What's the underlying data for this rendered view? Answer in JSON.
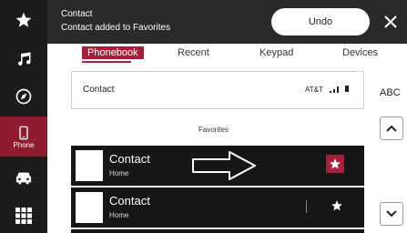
{
  "banner": {
    "title": "Contact",
    "message": "Contact added to Favorites",
    "undo_label": "Undo",
    "close_icon": "close-icon"
  },
  "sidebar": {
    "items": [
      {
        "name": "favorites",
        "icon": "star-icon",
        "label": ""
      },
      {
        "name": "music",
        "icon": "music-note-icon",
        "label": ""
      },
      {
        "name": "navigation",
        "icon": "compass-icon",
        "label": ""
      },
      {
        "name": "phone",
        "icon": "phone-icon",
        "label": "Phone",
        "active": true
      },
      {
        "name": "vehicle",
        "icon": "car-icon",
        "label": ""
      },
      {
        "name": "apps",
        "icon": "apps-grid-icon",
        "label": ""
      }
    ]
  },
  "tabs": [
    {
      "label": "Phonebook",
      "active": true
    },
    {
      "label": "Recent"
    },
    {
      "label": "Keypad"
    },
    {
      "label": "Devices"
    }
  ],
  "selected_contact": {
    "name": "Contact",
    "carrier": "AT&T",
    "signal_icon": "signal-icon",
    "battery_icon": "battery-icon"
  },
  "favorites": {
    "section_title": "Favorites",
    "items": [
      {
        "name": "Contact",
        "sub": "Home",
        "starred": true,
        "highlighted": true
      },
      {
        "name": "Contact",
        "sub": "Home",
        "starred": true,
        "highlighted": false
      }
    ]
  },
  "index": {
    "letters_label": "ABC",
    "up_icon": "chevron-up-icon",
    "down_icon": "chevron-down-icon"
  },
  "colors": {
    "accent": "#a5213a",
    "rail_bg": "#1b1b1b",
    "banner_bg": "#2a2a2a",
    "list_bg": "#161616"
  }
}
